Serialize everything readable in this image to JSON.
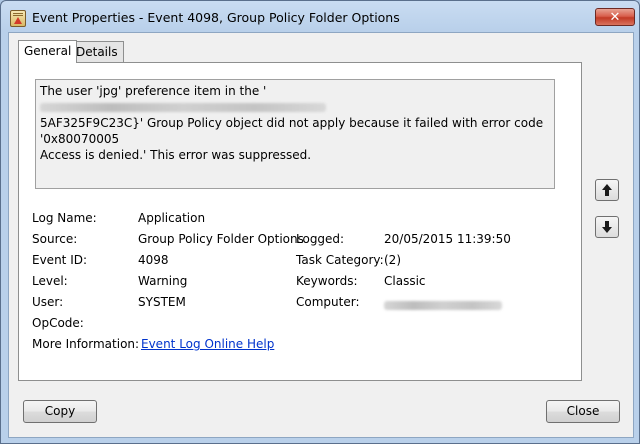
{
  "window": {
    "title": "Event Properties - Event 4098, Group Policy Folder Options",
    "close_glyph": "✕"
  },
  "tabs": [
    {
      "label": "General"
    },
    {
      "label": "Details"
    }
  ],
  "message": {
    "line1_prefix": "The user 'jpg' preference item in the '",
    "line2_suffix": "5AF325F9C23C}' Group Policy object did not apply because it failed with error code '0x80070005",
    "line3": "Access is denied.' This error was suppressed."
  },
  "details": {
    "log_name": {
      "label": "Log Name:",
      "value": "Application"
    },
    "source": {
      "label": "Source:",
      "value": "Group Policy Folder Options"
    },
    "logged": {
      "label": "Logged:",
      "value": "20/05/2015 11:39:50"
    },
    "event_id": {
      "label": "Event ID:",
      "value": "4098"
    },
    "task_category": {
      "label": "Task Category:",
      "value": "(2)"
    },
    "level": {
      "label": "Level:",
      "value": "Warning"
    },
    "keywords": {
      "label": "Keywords:",
      "value": "Classic"
    },
    "user": {
      "label": "User:",
      "value": "SYSTEM"
    },
    "computer": {
      "label": "Computer:"
    },
    "opcode": {
      "label": "OpCode:"
    },
    "more_info": {
      "label": "More Information:",
      "link": "Event Log Online Help"
    }
  },
  "buttons": {
    "copy": "Copy",
    "close": "Close"
  },
  "icons": {
    "up": "arrow-up-icon",
    "down": "arrow-down-icon"
  }
}
